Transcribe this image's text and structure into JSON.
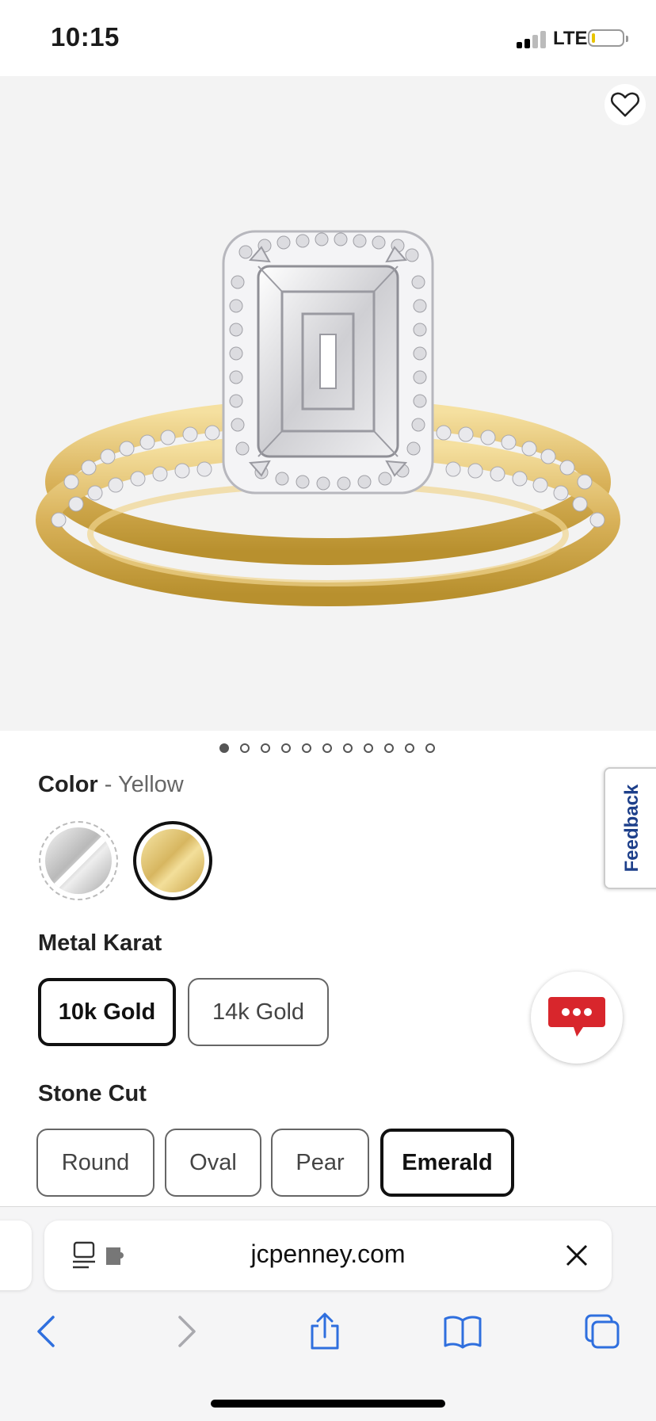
{
  "status_bar": {
    "time": "10:15",
    "network": "LTE"
  },
  "product": {
    "image_alt": "ring-image",
    "carousel": {
      "count": 11,
      "active_index": 0
    }
  },
  "color": {
    "label": "Color",
    "separator": " - ",
    "selected": "Yellow"
  },
  "metal_karat": {
    "label": "Metal Karat",
    "options": [
      "10k Gold",
      "14k Gold"
    ],
    "selected": "10k Gold"
  },
  "stone_cut": {
    "label": "Stone Cut",
    "options": [
      "Round",
      "Oval",
      "Pear",
      "Emerald"
    ],
    "selected": "Emerald"
  },
  "feedback": {
    "label": "Feedback"
  },
  "browser": {
    "url": "jcpenney.com"
  },
  "colors": {
    "accent_blue": "#2f6fde",
    "chat_red": "#d8262c",
    "feedback_blue": "#1d3f8a"
  }
}
